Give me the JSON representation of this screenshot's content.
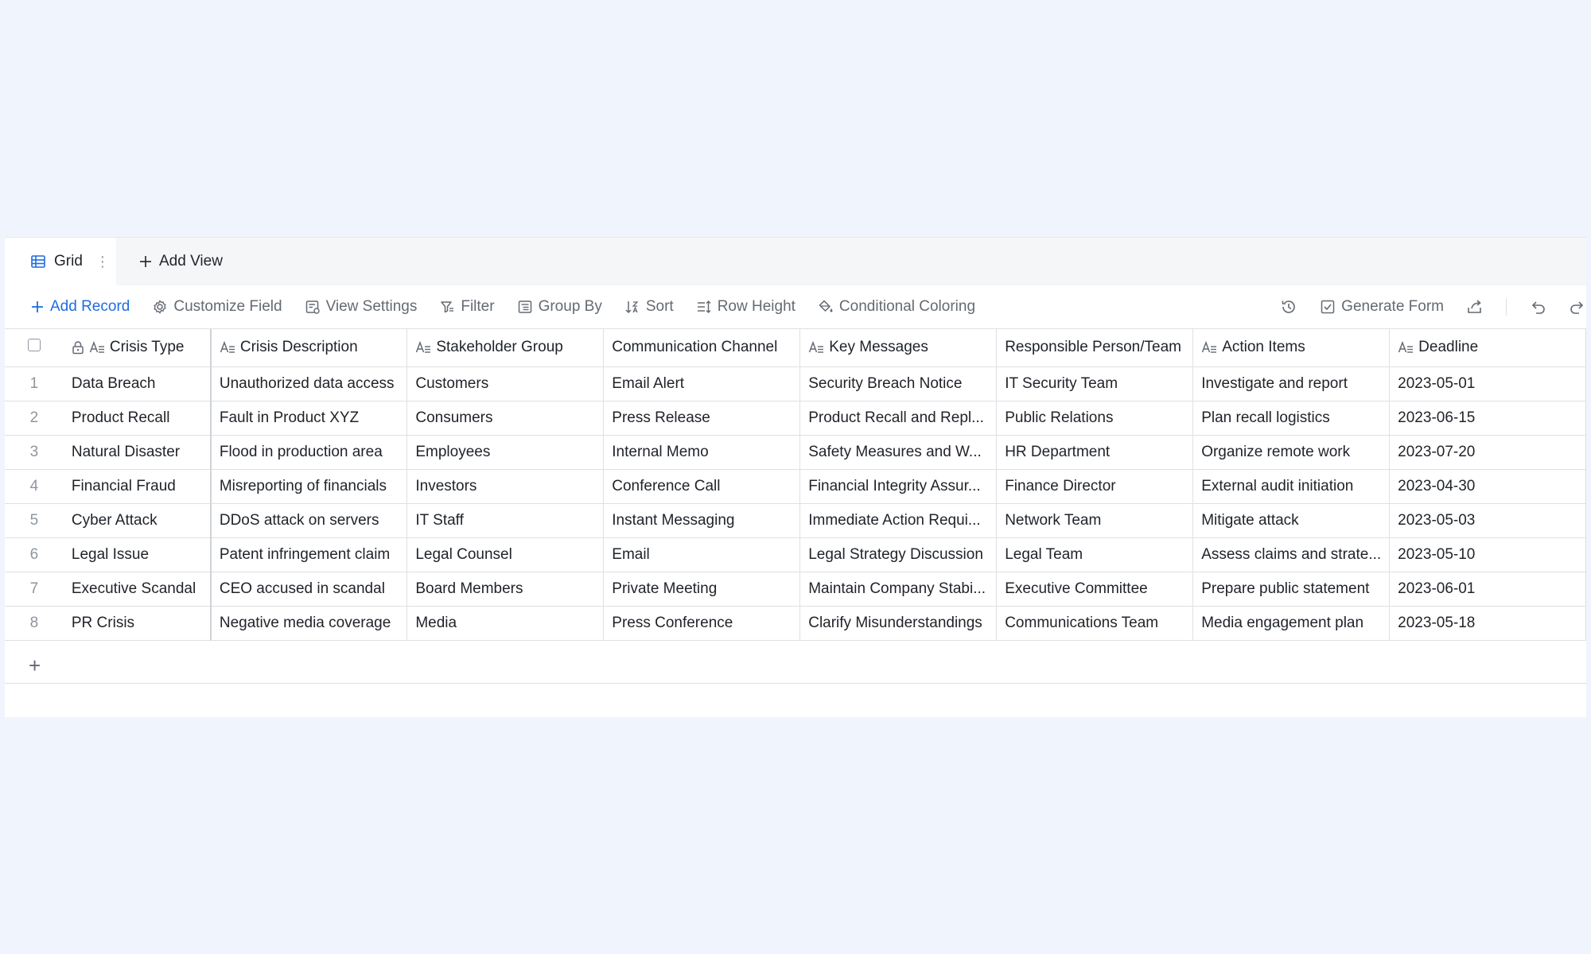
{
  "views": {
    "active_tab": "Grid",
    "add_view_label": "Add View"
  },
  "toolbar": {
    "add_record": "Add Record",
    "customize_field": "Customize Field",
    "view_settings": "View Settings",
    "filter": "Filter",
    "group_by": "Group By",
    "sort": "Sort",
    "row_height": "Row Height",
    "conditional_coloring": "Conditional Coloring",
    "generate_form": "Generate Form"
  },
  "table": {
    "columns": [
      {
        "label": "Crisis Type",
        "icon": "text-field-icon",
        "locked": true
      },
      {
        "label": "Crisis Description",
        "icon": "text-field-icon"
      },
      {
        "label": "Stakeholder Group",
        "icon": "text-field-icon"
      },
      {
        "label": "Communication Channel",
        "icon": ""
      },
      {
        "label": "Key Messages",
        "icon": "text-field-icon"
      },
      {
        "label": "Responsible Person/Team",
        "icon": ""
      },
      {
        "label": "Action Items",
        "icon": "text-field-icon"
      },
      {
        "label": "Deadline",
        "icon": "text-field-icon"
      }
    ],
    "rows": [
      {
        "num": "1",
        "cells": [
          "Data Breach",
          "Unauthorized data access",
          "Customers",
          "Email Alert",
          "Security Breach Notice",
          "IT Security Team",
          "Investigate and report",
          "2023-05-01"
        ]
      },
      {
        "num": "2",
        "cells": [
          "Product Recall",
          "Fault in Product XYZ",
          "Consumers",
          "Press Release",
          "Product Recall and Repl...",
          "Public Relations",
          "Plan recall logistics",
          "2023-06-15"
        ]
      },
      {
        "num": "3",
        "cells": [
          "Natural Disaster",
          "Flood in production area",
          "Employees",
          "Internal Memo",
          "Safety Measures and W...",
          "HR Department",
          "Organize remote work",
          "2023-07-20"
        ]
      },
      {
        "num": "4",
        "cells": [
          "Financial Fraud",
          "Misreporting of financials",
          "Investors",
          "Conference Call",
          "Financial Integrity Assur...",
          "Finance Director",
          "External audit initiation",
          "2023-04-30"
        ]
      },
      {
        "num": "5",
        "cells": [
          "Cyber Attack",
          "DDoS attack on servers",
          "IT Staff",
          "Instant Messaging",
          "Immediate Action Requi...",
          "Network Team",
          "Mitigate attack",
          "2023-05-03"
        ]
      },
      {
        "num": "6",
        "cells": [
          "Legal Issue",
          "Patent infringement claim",
          "Legal Counsel",
          "Email",
          "Legal Strategy Discussion",
          "Legal Team",
          "Assess claims and strate...",
          "2023-05-10"
        ]
      },
      {
        "num": "7",
        "cells": [
          "Executive Scandal",
          "CEO accused in scandal",
          "Board Members",
          "Private Meeting",
          "Maintain Company Stabi...",
          "Executive Committee",
          "Prepare public statement",
          "2023-06-01"
        ]
      },
      {
        "num": "8",
        "cells": [
          "PR Crisis",
          "Negative media coverage",
          "Media",
          "Press Conference",
          "Clarify Misunderstandings",
          "Communications Team",
          "Media engagement plan",
          "2023-05-18"
        ]
      }
    ],
    "add_row_icon": "plus-icon"
  },
  "colors": {
    "accent": "#1f6ce0",
    "background": "#f0f4fd",
    "border": "#dee0e3"
  }
}
